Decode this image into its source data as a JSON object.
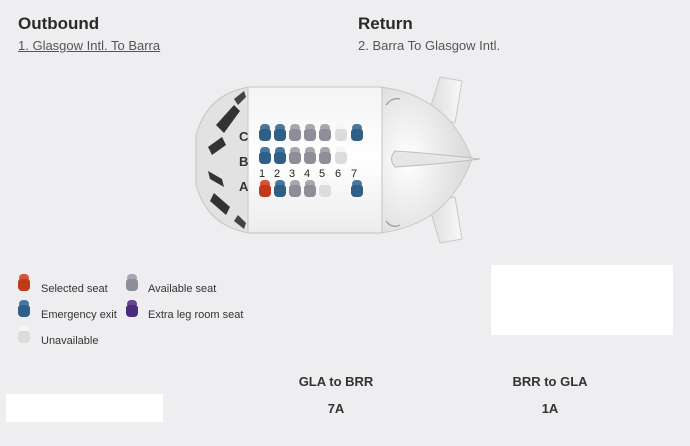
{
  "outbound": {
    "heading": "Outbound",
    "flight": "1.  Glasgow Intl. To Barra"
  },
  "return": {
    "heading": "Return",
    "flight": "2.  Barra To Glasgow Intl."
  },
  "seatmap": {
    "rows": [
      "C",
      "B",
      "A"
    ],
    "columns": [
      "1",
      "2",
      "3",
      "4",
      "5",
      "6",
      "7"
    ],
    "seats": {
      "C": [
        "emergency",
        "emergency",
        "available",
        "available",
        "available",
        "unavailable",
        "emergency"
      ],
      "B": [
        "emergency",
        "emergency",
        "available",
        "available",
        "available",
        "unavailable",
        null
      ],
      "A": [
        "selected",
        "emergency",
        "available",
        "available",
        "unavailable",
        null,
        "emergency"
      ]
    }
  },
  "legend": {
    "selected": "Selected seat",
    "available": "Available seat",
    "emergency": "Emergency exit",
    "extra_leg": "Extra leg room seat",
    "unavailable": "Unavailable"
  },
  "colors": {
    "selected": "#c0391c",
    "emergency": "#2f5f86",
    "available": "#8e8e98",
    "extra_leg": "#4a2c7a",
    "unavailable": "#dcdcdc"
  },
  "summary": {
    "outbound_route": "GLA to BRR",
    "outbound_seat": "7A",
    "return_route": "BRR to GLA",
    "return_seat": "1A"
  }
}
